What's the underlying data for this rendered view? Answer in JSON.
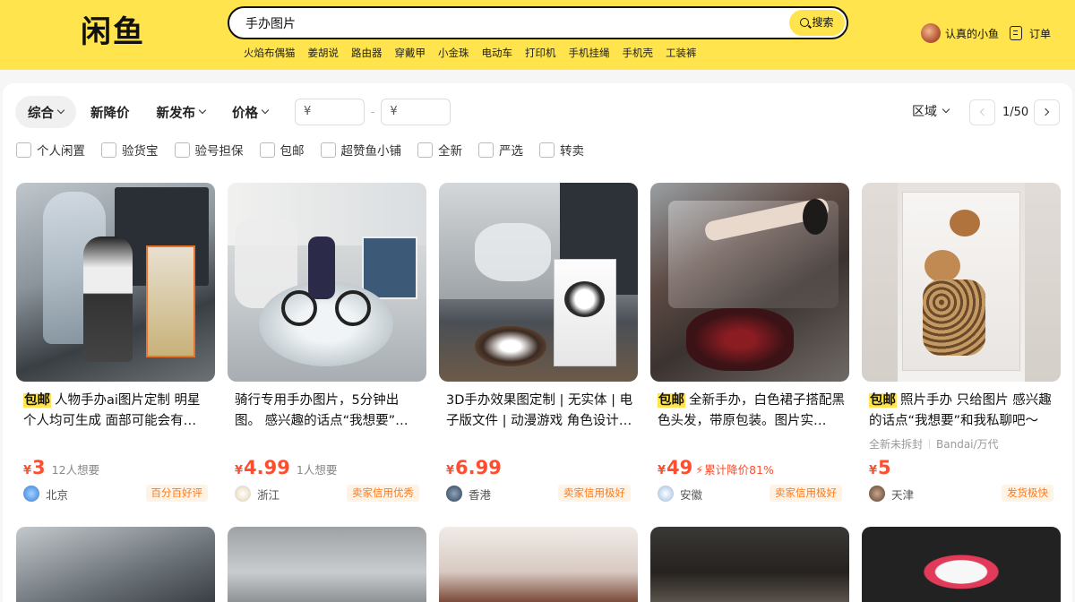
{
  "header": {
    "logo": "闲鱼",
    "search_value": "手办图片",
    "search_button": "搜索",
    "suggestions": [
      "火焰布偶猫",
      "姜胡说",
      "路由器",
      "穿戴甲",
      "小金珠",
      "电动车",
      "打印机",
      "手机挂绳",
      "手机壳",
      "工装裤"
    ],
    "user_name": "认真的小鱼",
    "orders_label": "订单"
  },
  "filters": {
    "sort_tabs": [
      "综合",
      "新降价",
      "新发布",
      "价格"
    ],
    "price_min_placeholder": "¥",
    "price_max_placeholder": "¥",
    "price_dash": "-",
    "region": "区域",
    "page": "1/50",
    "checkboxes": [
      "个人闲置",
      "验货宝",
      "验号担保",
      "包邮",
      "超赞鱼小铺",
      "全新",
      "严选",
      "转卖"
    ]
  },
  "products": [
    {
      "badge": "包邮",
      "title": "人物手办ai图片定制 明星个人均可生成 面部可能会有…",
      "currency": "¥",
      "price": "3",
      "want": "12人想要",
      "location": "北京",
      "tag": "百分百好评"
    },
    {
      "badge": "",
      "title": "骑行专用手办图片，5分钟出图。 感兴趣的话点“我想要”…",
      "currency": "¥",
      "price": "4.99",
      "want": "1人想要",
      "location": "浙江",
      "tag": "卖家信用优秀"
    },
    {
      "badge": "",
      "title": "3D手办效果图定制 | 无实体 | 电子版文件 | 动漫游戏 角色设计…",
      "currency": "¥",
      "price": "6.99",
      "want": "",
      "location": "香港",
      "tag": "卖家信用极好"
    },
    {
      "badge": "包邮",
      "title": "全新手办，白色裙子搭配黑色头发，带原包装。图片实…",
      "currency": "¥",
      "price": "49",
      "drop": "累计降价81%",
      "location": "安徽",
      "tag": "卖家信用极好"
    },
    {
      "badge": "包邮",
      "title": "照片手办 只给图片 感兴趣的话点“我想要”和我私聊吧～",
      "sub1": "全新未拆封",
      "sub2": "Bandai/万代",
      "currency": "¥",
      "price": "5",
      "want": "",
      "location": "天津",
      "tag": "发货极快"
    }
  ],
  "colors": {
    "brand": "#ffe44d",
    "price": "#ff4d2e",
    "tag": "#ff7a1a"
  }
}
